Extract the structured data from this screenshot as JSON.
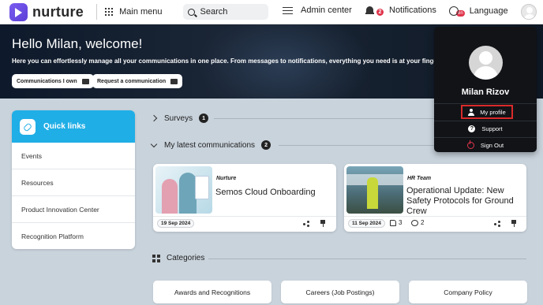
{
  "app": {
    "brand": "nurture",
    "main_menu": "Main menu",
    "search_label": "Search",
    "admin_center": "Admin center",
    "notifications": {
      "label": "Notifications",
      "count": "2"
    },
    "language": {
      "label": "Language",
      "code": "en"
    }
  },
  "hero": {
    "title": "Hello Milan, welcome!",
    "subtitle": "Here you can effortlessly manage all your communications in one place. From messages to notifications, everything you need is at your fingertips.",
    "buttons": [
      "Communications I own",
      "Request a communication"
    ]
  },
  "quick_links": {
    "title": "Quick links",
    "items": [
      "Events",
      "Resources",
      "Product Innovation Center",
      "Recognition Platform"
    ]
  },
  "surveys": {
    "label": "Surveys",
    "count": "1"
  },
  "communications": {
    "label": "My latest communications",
    "count": "2",
    "cards": [
      {
        "org": "Nurture",
        "title": "Semos Cloud Onboarding",
        "date": "19 Sep 2024"
      },
      {
        "org": "HR Team",
        "title": "Operational Update: New Safety Protocols for Ground Crew",
        "date": "11 Sep 2024",
        "likes": "3",
        "comments": "2"
      }
    ]
  },
  "categories": {
    "label": "Categories",
    "items": [
      "Awards and Recognitions",
      "Careers (Job Postings)",
      "Company Policy"
    ]
  },
  "profile_menu": {
    "name": "Milan Rizov",
    "items": [
      "My profile",
      "Support",
      "Sign Out"
    ]
  },
  "colors": {
    "accent": "#20aee6",
    "brand": "#6a4ce3",
    "highlight_border": "#d92a2a",
    "badge": "#e0344b"
  }
}
